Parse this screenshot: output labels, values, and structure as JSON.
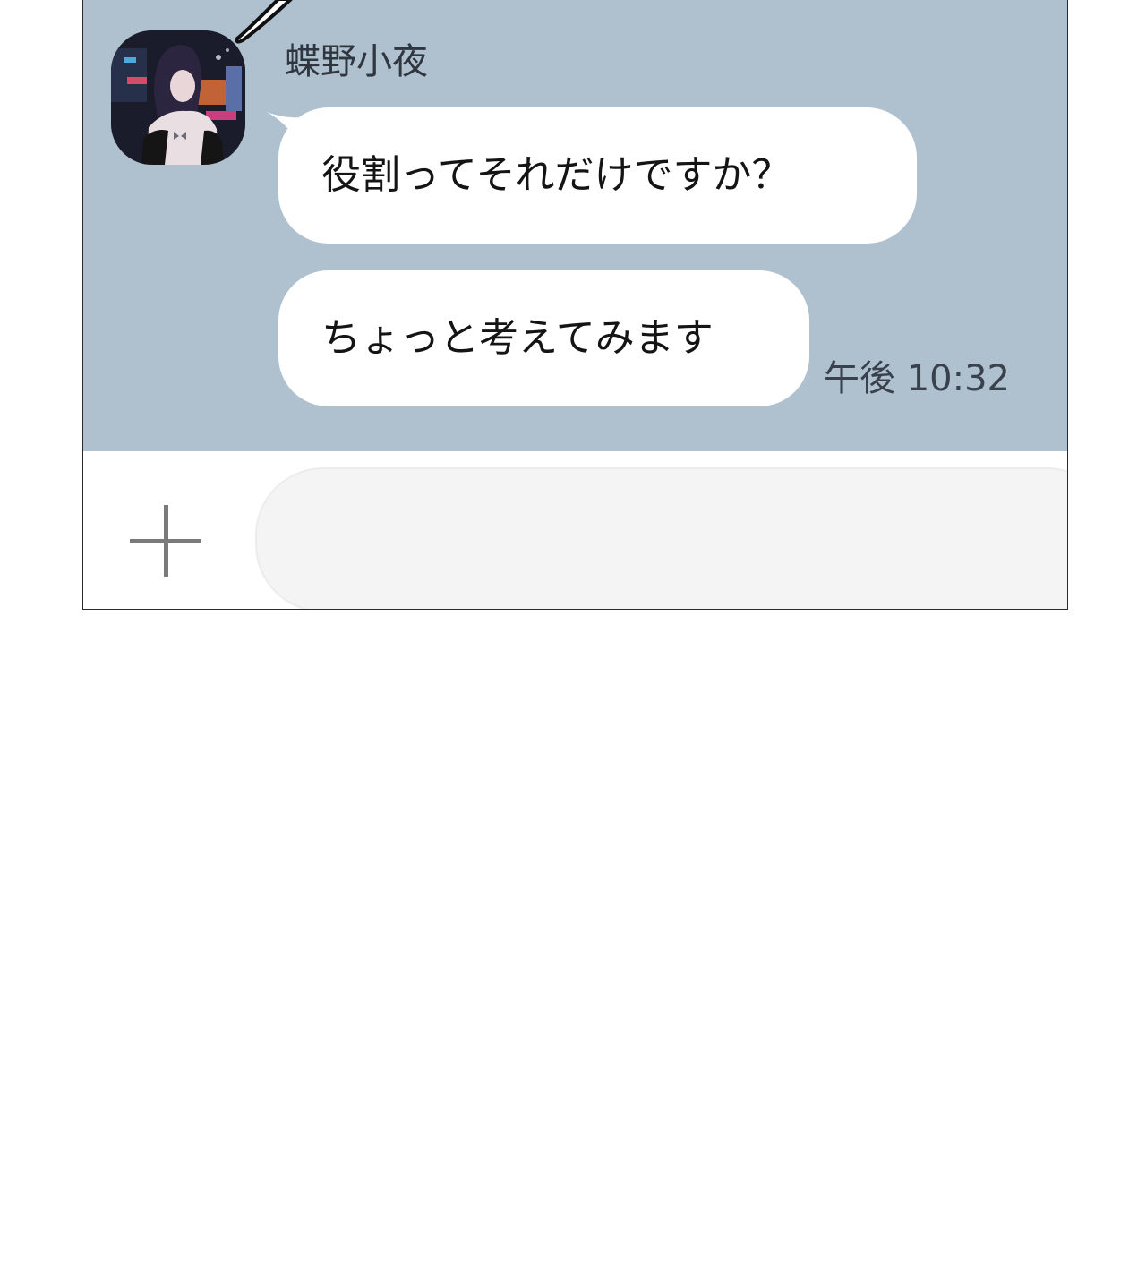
{
  "conversation": {
    "contact_name": "蝶野小夜",
    "messages": [
      {
        "text": "役割ってそれだけですか？"
      },
      {
        "text": "ちょっと考えてみます"
      }
    ],
    "last_timestamp": "午後 10:32"
  },
  "input_bar": {
    "plus_icon": "plus-icon",
    "message_value": ""
  },
  "colors": {
    "chat_background": "#afc0cf",
    "bubble_background": "#ffffff",
    "input_background": "#f4f4f4"
  }
}
